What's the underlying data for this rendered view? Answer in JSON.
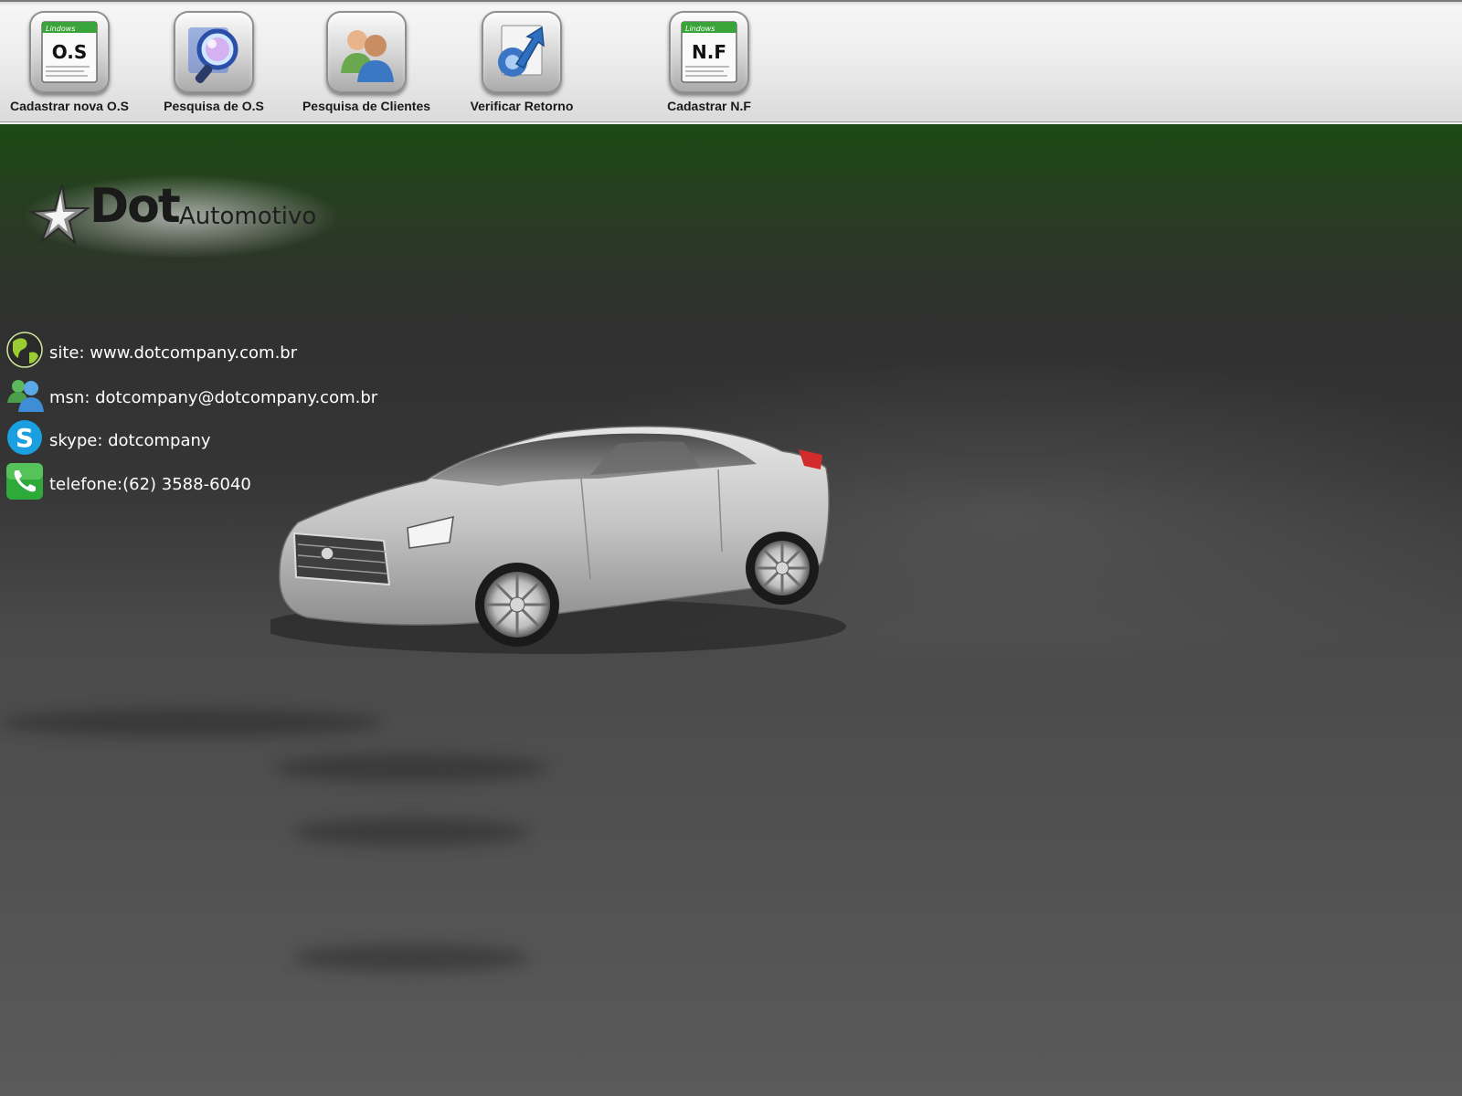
{
  "toolbar": {
    "items": [
      {
        "label": "Cadastrar nova O.S",
        "icon": "os-document-icon",
        "icon_text": "O.S"
      },
      {
        "label": "Pesquisa de O.S",
        "icon": "magnifier-search-icon"
      },
      {
        "label": "Pesquisa de Clientes",
        "icon": "users-icon"
      },
      {
        "label": "Verificar Retorno",
        "icon": "return-arrow-icon"
      },
      {
        "label": "Cadastrar N.F",
        "icon": "nf-document-icon",
        "icon_text": "N.F"
      }
    ]
  },
  "logo": {
    "brand": "Dot",
    "suffix": "Automotivo",
    "icon": "star-icon"
  },
  "contacts": [
    {
      "icon": "globe-icon",
      "text": "site: www.dotcompany.com.br"
    },
    {
      "icon": "msn-users-icon",
      "text": "msn: dotcompany@dotcompany.com.br"
    },
    {
      "icon": "skype-icon",
      "text": "skype: dotcompany"
    },
    {
      "icon": "phone-icon",
      "text": "telefone:(62) 3588-6040"
    }
  ],
  "colors": {
    "header_green": "#1b4a14",
    "background_gray": "#353535",
    "toolbar_bg": "#eeeeee",
    "skype_blue": "#1a9fe0",
    "phone_green": "#2eaa3a",
    "car_silver": "#c9c9c9"
  }
}
